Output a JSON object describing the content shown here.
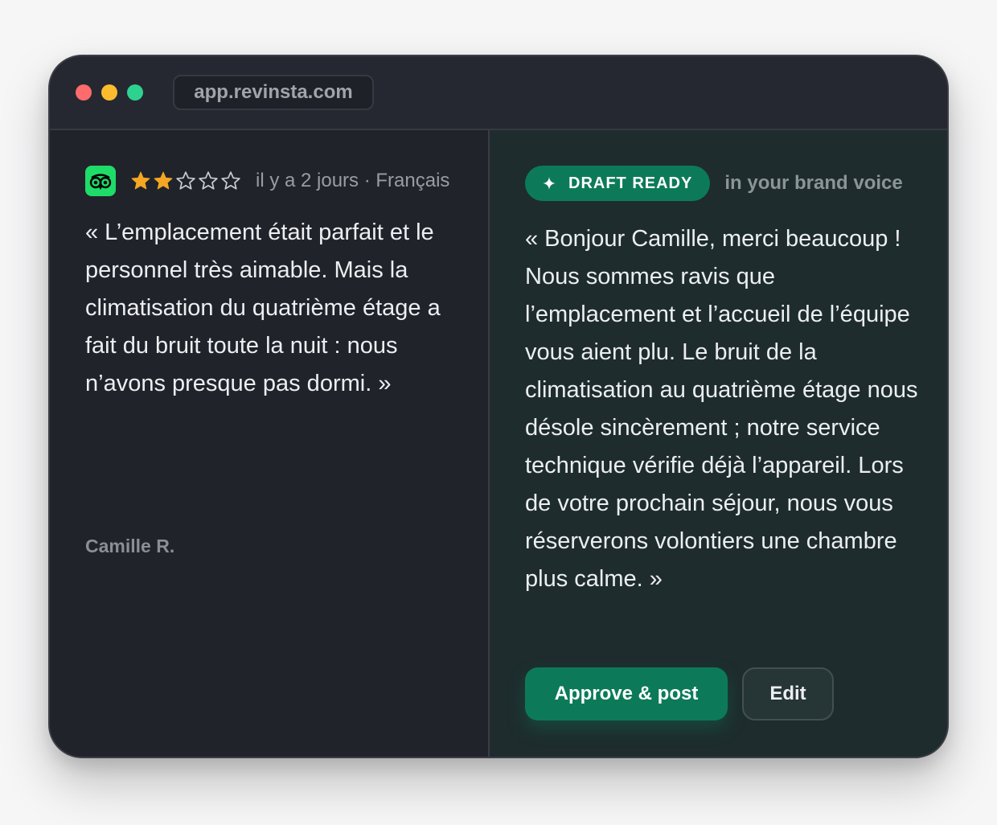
{
  "window": {
    "url": "app.revinsta.com"
  },
  "review": {
    "platform_icon": "tripadvisor-owl-icon",
    "rating": 2,
    "rating_max": 5,
    "meta": "il y a 2 jours · Français",
    "text": "« L’emplacement était parfait et le personnel très aimable. Mais la climatisation du quatrième étage a fait du bruit toute la nuit : nous n’avons presque pas dormi. »",
    "author": "Camille R."
  },
  "draft": {
    "badge_icon": "sparkle-icon",
    "badge_label": "DRAFT READY",
    "subtitle": "in your brand voice",
    "text": "« Bonjour Camille, merci beaucoup ! Nous sommes ravis que l’emplacement et l’accueil de l’équipe vous aient plu. Le bruit de la climatisation au quatrième étage nous désole sincèrement ; notre service technique vérifie déjà l’appareil. Lors de votre prochain séjour, nous vous réserverons volontiers une chambre plus calme. »",
    "approve_label": "Approve & post",
    "edit_label": "Edit"
  },
  "colors": {
    "accent": "#0c7a59",
    "star_filled": "#f5a623",
    "tripadvisor": "#1fdc68"
  }
}
